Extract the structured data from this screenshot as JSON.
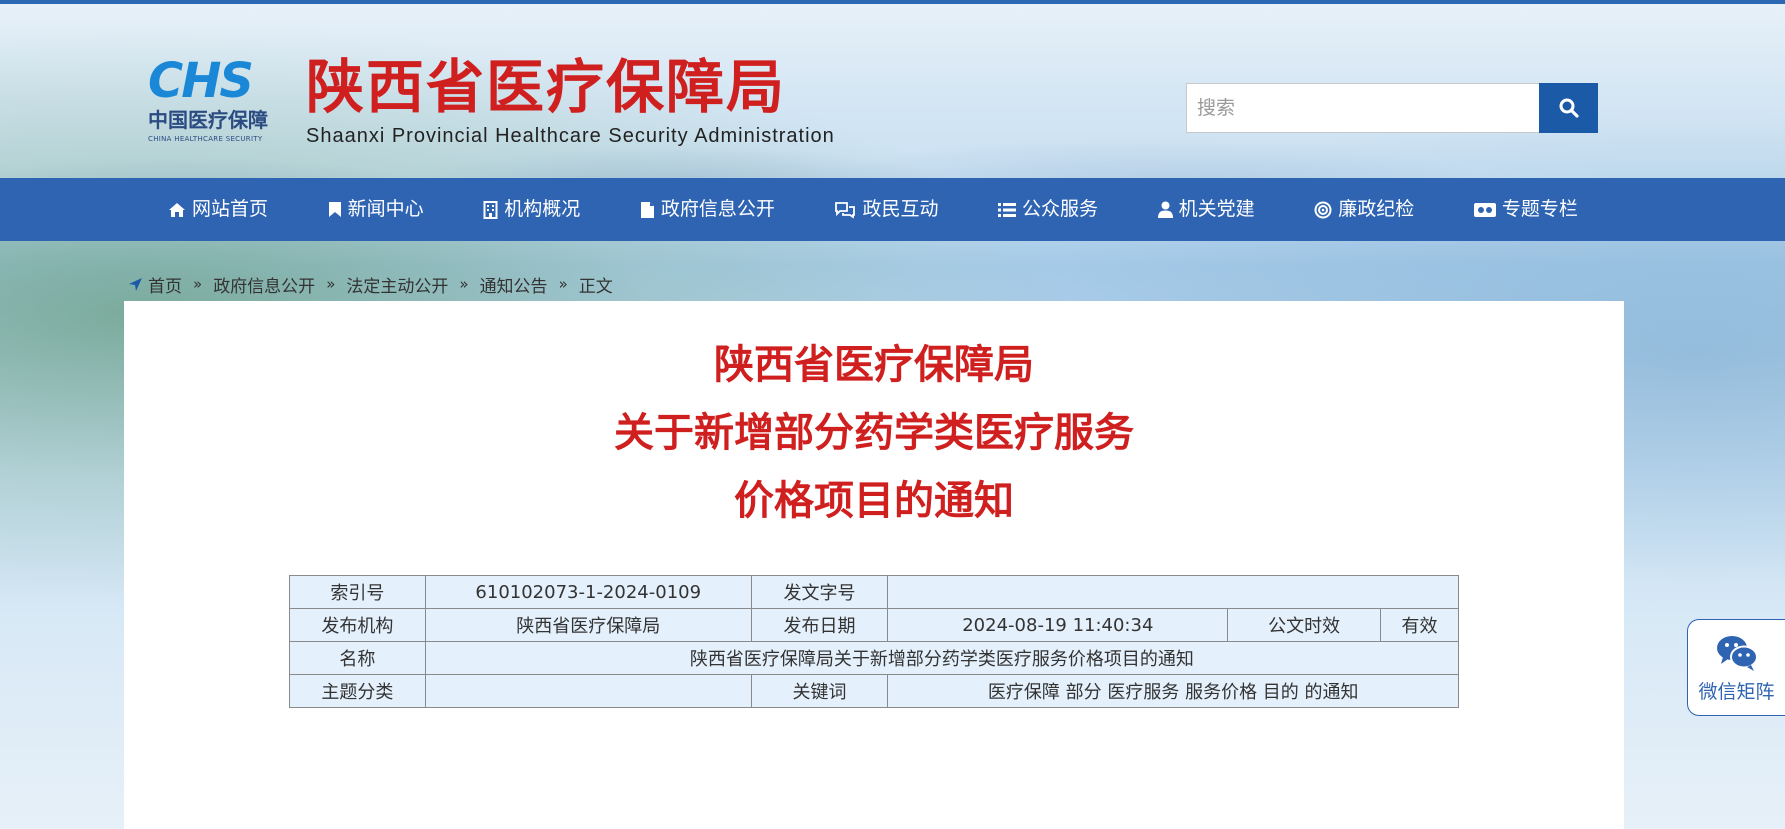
{
  "header": {
    "logo_mark": "CHS",
    "logo_cn": "中国医疗保障",
    "logo_en": "CHINA HEALTHCARE SECURITY",
    "title_cn": "陕西省医疗保障局",
    "title_en": "Shaanxi Provincial Healthcare Security Administration"
  },
  "search": {
    "placeholder": "搜索",
    "value": ""
  },
  "nav": {
    "items": [
      {
        "label": "网站首页",
        "icon": "home-icon"
      },
      {
        "label": "新闻中心",
        "icon": "bookmark-icon"
      },
      {
        "label": "机构概况",
        "icon": "building-icon"
      },
      {
        "label": "政府信息公开",
        "icon": "file-icon"
      },
      {
        "label": "政民互动",
        "icon": "chat-icon"
      },
      {
        "label": "公众服务",
        "icon": "list-icon"
      },
      {
        "label": "机关党建",
        "icon": "user-icon"
      },
      {
        "label": "廉政纪检",
        "icon": "target-icon"
      },
      {
        "label": "专题专栏",
        "icon": "film-icon"
      }
    ]
  },
  "breadcrumb": {
    "items": [
      "首页",
      "政府信息公开",
      "法定主动公开",
      "通知公告",
      "正文"
    ],
    "separator": "»"
  },
  "document": {
    "title_lines": [
      "陕西省医疗保障局",
      "关于新增部分药学类医疗服务",
      "价格项目的通知"
    ]
  },
  "meta": {
    "index_label": "索引号",
    "index_value": "610102073-1-2024-0109",
    "doc_no_label": "发文字号",
    "doc_no_value": "",
    "publisher_label": "发布机构",
    "publisher_value": "陕西省医疗保障局",
    "date_label": "发布日期",
    "date_value": "2024-08-19 11:40:34",
    "validity_label": "公文时效",
    "validity_value": "有效",
    "name_label": "名称",
    "name_value": "陕西省医疗保障局关于新增部分药学类医疗服务价格项目的通知",
    "topic_label": "主题分类",
    "topic_value": "",
    "keywords_label": "关键词",
    "keywords_value": "医疗保障 部分 医疗服务 服务价格 目的 的通知"
  },
  "wechat": {
    "label": "微信矩阵"
  },
  "colors": {
    "nav_bg": "#2f64b3",
    "title_red": "#d01f1f",
    "search_btn": "#1b5aa6",
    "table_bg": "#e4f0fb"
  }
}
